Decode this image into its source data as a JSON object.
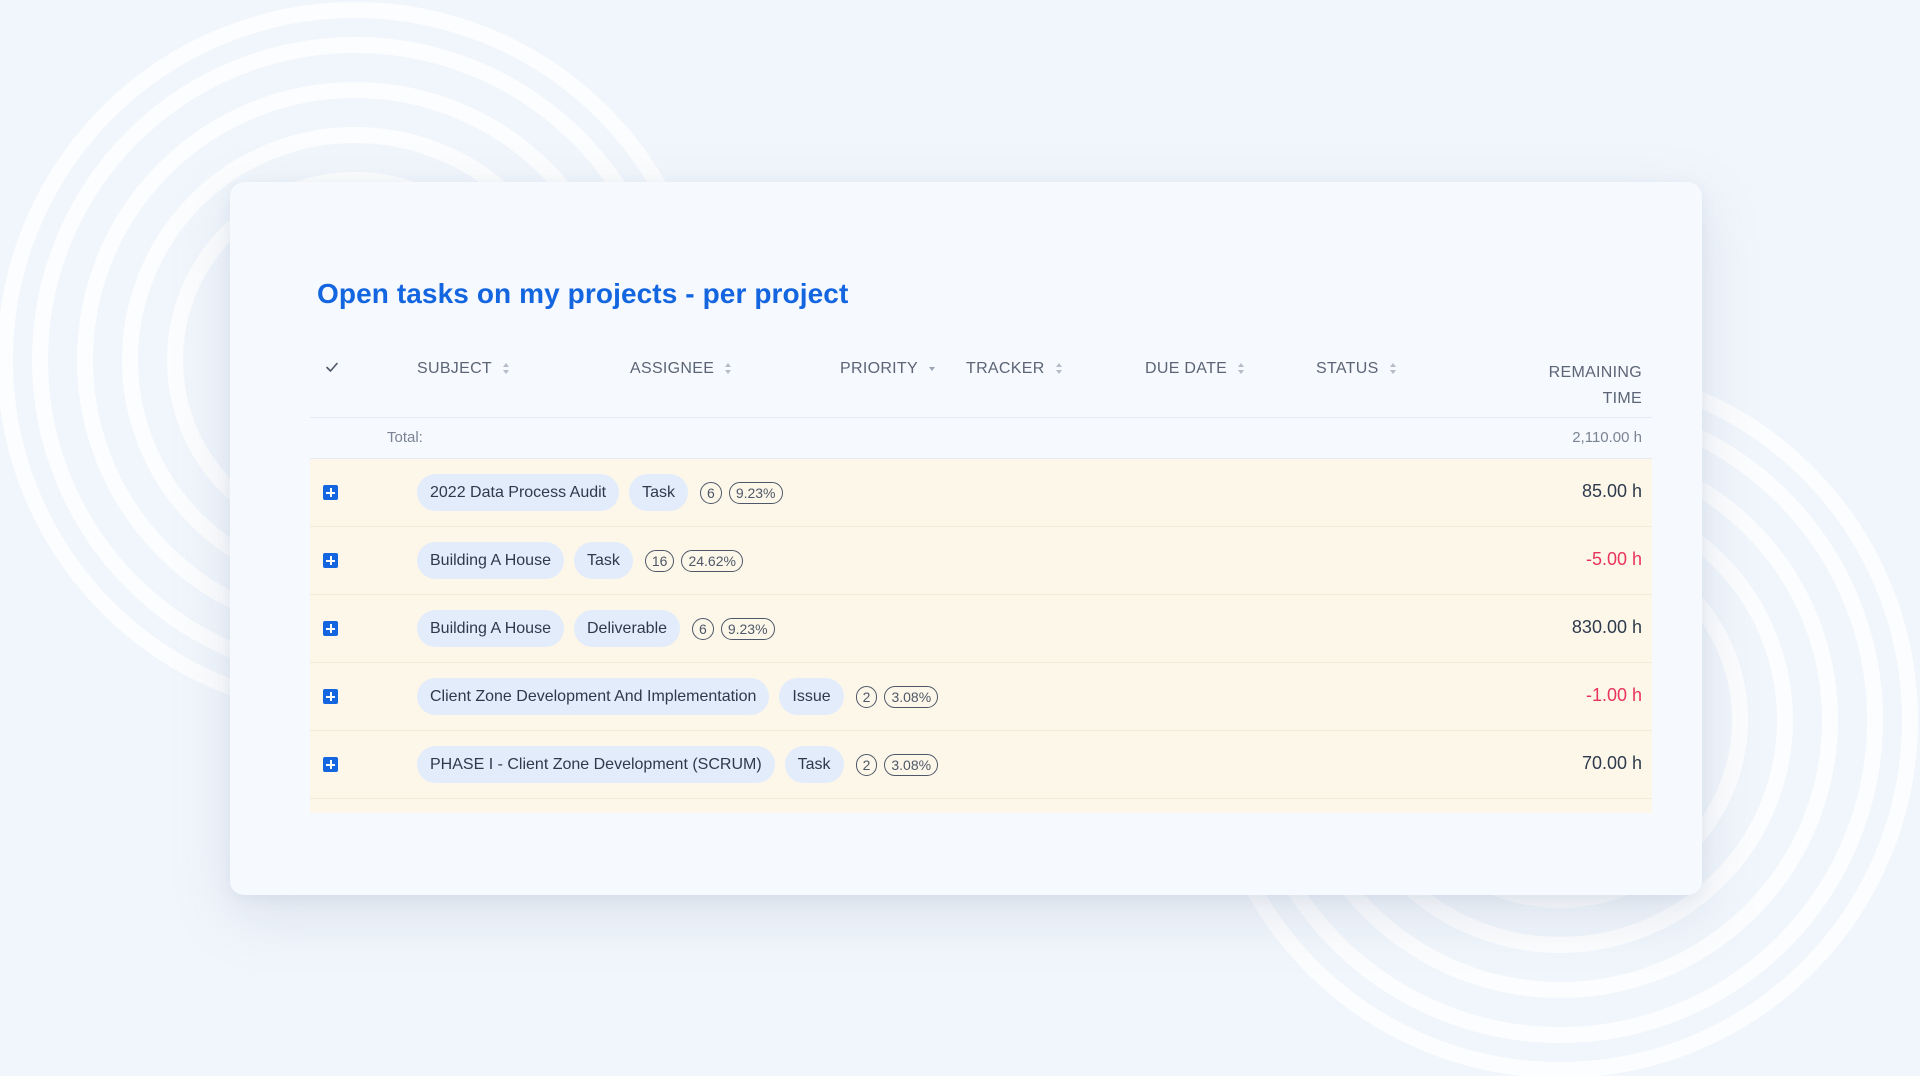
{
  "widget": {
    "title": "Open tasks on my projects - per project"
  },
  "columns": {
    "subject": "SUBJECT",
    "assignee": "ASSIGNEE",
    "priority": "PRIORITY",
    "tracker": "TRACKER",
    "due_date": "DUE DATE",
    "status": "STATUS",
    "remaining_1": "REMAINING",
    "remaining_2": "TIME"
  },
  "total": {
    "label": "Total:",
    "value": "2,110.00 h"
  },
  "rows": [
    {
      "project": "2022 Data Process Audit",
      "tracker": "Task",
      "count": "6",
      "percent": "9.23%",
      "remaining": "85.00 h",
      "negative": false
    },
    {
      "project": "Building A House",
      "tracker": "Task",
      "count": "16",
      "percent": "24.62%",
      "remaining": "-5.00 h",
      "negative": true
    },
    {
      "project": "Building A House",
      "tracker": "Deliverable",
      "count": "6",
      "percent": "9.23%",
      "remaining": "830.00 h",
      "negative": false
    },
    {
      "project": "Client Zone Development And Implementation",
      "tracker": "Issue",
      "count": "2",
      "percent": "3.08%",
      "remaining": "-1.00 h",
      "negative": true
    },
    {
      "project": "PHASE I - Client Zone Development (SCRUM)",
      "tracker": "Task",
      "count": "2",
      "percent": "3.08%",
      "remaining": "70.00 h",
      "negative": false
    }
  ],
  "colors": {
    "accent": "#1366e0",
    "negative": "#e8345b",
    "row_highlight": "#fdf7ea",
    "pill": "#e3ecfa"
  },
  "icons": {
    "select_all": "check-icon",
    "expand": "plus-square-icon",
    "sort": "sort-arrows-icon"
  }
}
